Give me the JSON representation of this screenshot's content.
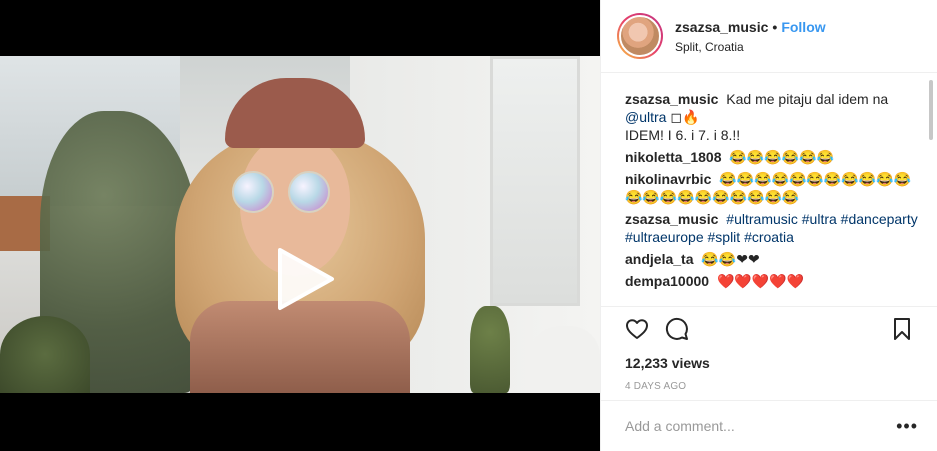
{
  "post": {
    "username": "zsazsa_music",
    "separator": "•",
    "follow_label": "Follow",
    "location": "Split, Croatia"
  },
  "comments": [
    {
      "user": "zsazsa_music",
      "text": "Kad me pitaju dal idem na",
      "mention": "@ultra",
      "text2": "◻🔥",
      "line2": "IDEM! I 6. i 7. i 8.!!"
    },
    {
      "user": "nikoletta_1808",
      "text": "😂😂😂😂😂😂"
    },
    {
      "user": "nikolinavrbic",
      "text": "😂😂😂😂😂😂😂😂😂😂😂😂😂😂😂😂😂😂😂😂😂"
    },
    {
      "user": "zsazsa_music",
      "hashtags": "#ultramusic #ultra #danceparty #ultraeurope #split #croatia"
    },
    {
      "user": "andjela_ta",
      "text": "😂😂❤❤"
    },
    {
      "user": "dempa10000",
      "text": "❤️❤️❤️❤️❤️"
    }
  ],
  "icons": {
    "like": "heart-icon",
    "comment": "comment-icon",
    "save": "bookmark-icon",
    "play": "play-icon",
    "more": "more-options-icon"
  },
  "stats": {
    "views": "12,233 views",
    "time_ago": "4 DAYS AGO"
  },
  "add_comment": {
    "placeholder": "Add a comment...",
    "more_glyph": "•••"
  }
}
